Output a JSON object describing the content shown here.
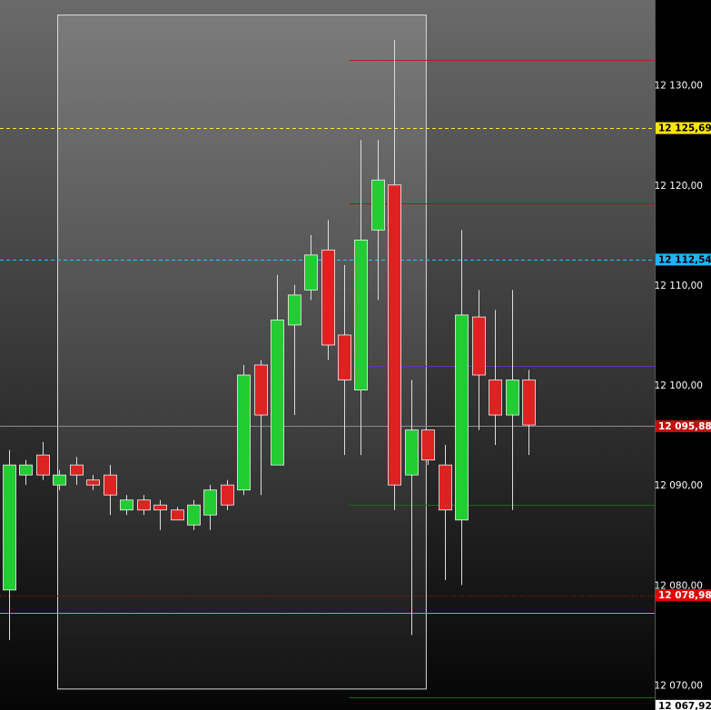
{
  "chart_data": {
    "type": "candlestick",
    "title": "",
    "xlabel": "",
    "ylabel": "",
    "ylim": [
      12067.5,
      12138.5
    ],
    "y_ticks": [
      {
        "value": 12130,
        "label": "12 130,00"
      },
      {
        "value": 12120,
        "label": "12 120,00"
      },
      {
        "value": 12110,
        "label": "12 110,00"
      },
      {
        "value": 12100,
        "label": "12 100,00"
      },
      {
        "value": 12090,
        "label": "12 090,00"
      },
      {
        "value": 12080,
        "label": "12 080,00"
      },
      {
        "value": 12070,
        "label": "12 070,00"
      }
    ],
    "candles": [
      {
        "o": 12079.5,
        "h": 12093.5,
        "l": 12074.5,
        "c": 12092.0
      },
      {
        "o": 12091.0,
        "h": 12092.5,
        "l": 12090.0,
        "c": 12092.0
      },
      {
        "o": 12093.0,
        "h": 12094.3,
        "l": 12090.5,
        "c": 12091.0
      },
      {
        "o": 12090.0,
        "h": 12091.5,
        "l": 12089.5,
        "c": 12091.0
      },
      {
        "o": 12092.0,
        "h": 12092.8,
        "l": 12090.0,
        "c": 12091.0
      },
      {
        "o": 12090.5,
        "h": 12091.0,
        "l": 12089.5,
        "c": 12090.0
      },
      {
        "o": 12091.0,
        "h": 12092.0,
        "l": 12087.0,
        "c": 12089.0
      },
      {
        "o": 12087.5,
        "h": 12089.0,
        "l": 12087.0,
        "c": 12088.5
      },
      {
        "o": 12088.5,
        "h": 12089.0,
        "l": 12087.0,
        "c": 12087.5
      },
      {
        "o": 12088.0,
        "h": 12088.5,
        "l": 12085.5,
        "c": 12087.5
      },
      {
        "o": 12087.5,
        "h": 12087.8,
        "l": 12086.5,
        "c": 12086.5
      },
      {
        "o": 12086.0,
        "h": 12088.5,
        "l": 12085.5,
        "c": 12088.0
      },
      {
        "o": 12087.0,
        "h": 12090.0,
        "l": 12085.5,
        "c": 12089.5
      },
      {
        "o": 12090.0,
        "h": 12090.5,
        "l": 12087.5,
        "c": 12088.0
      },
      {
        "o": 12089.5,
        "h": 12102.0,
        "l": 12089.0,
        "c": 12101.0
      },
      {
        "o": 12102.0,
        "h": 12102.5,
        "l": 12089.0,
        "c": 12097.0
      },
      {
        "o": 12092.0,
        "h": 12111.0,
        "l": 12092.0,
        "c": 12106.5
      },
      {
        "o": 12106.0,
        "h": 12110.0,
        "l": 12097.0,
        "c": 12109.0
      },
      {
        "o": 12109.5,
        "h": 12115.0,
        "l": 12108.5,
        "c": 12113.0
      },
      {
        "o": 12113.5,
        "h": 12116.5,
        "l": 12102.5,
        "c": 12104.0
      },
      {
        "o": 12105.0,
        "h": 12112.0,
        "l": 12093.0,
        "c": 12100.5
      },
      {
        "o": 12099.5,
        "h": 12124.5,
        "l": 12093.0,
        "c": 12114.5
      },
      {
        "o": 12115.5,
        "h": 12124.5,
        "l": 12108.5,
        "c": 12120.5
      },
      {
        "o": 12120.0,
        "h": 12134.5,
        "l": 12087.5,
        "c": 12090.0
      },
      {
        "o": 12091.0,
        "h": 12100.5,
        "l": 12075.0,
        "c": 12095.5
      },
      {
        "o": 12095.5,
        "h": 12095.5,
        "l": 12092.0,
        "c": 12092.5
      },
      {
        "o": 12092.0,
        "h": 12094.0,
        "l": 12080.5,
        "c": 12087.5
      },
      {
        "o": 12086.5,
        "h": 12115.5,
        "l": 12080.0,
        "c": 12107.0
      },
      {
        "o": 12106.8,
        "h": 12109.5,
        "l": 12095.5,
        "c": 12101.0
      },
      {
        "o": 12100.5,
        "h": 12107.5,
        "l": 12094.0,
        "c": 12097.0
      },
      {
        "o": 12097.0,
        "h": 12109.5,
        "l": 12087.5,
        "c": 12100.5
      },
      {
        "o": 12100.5,
        "h": 12101.5,
        "l": 12093.0,
        "c": 12096.0
      }
    ],
    "markers": [
      {
        "value": 12125.69,
        "label": "12 125,69",
        "line": "#ffe53a",
        "style": "dashed",
        "bg": "#ffe600",
        "fg": "#000000",
        "x_from": 0
      },
      {
        "value": 12112.54,
        "label": "12 112,54",
        "line": "#1ec8ff",
        "style": "dashed",
        "bg": "#1eb4ff",
        "fg": "#000000",
        "x_from": 0
      },
      {
        "value": 12095.88,
        "label": "12 095,88",
        "line": "#8a8a8a",
        "style": "solid",
        "bg": "#c01010",
        "fg": "#ffffff",
        "x_from": 0
      },
      {
        "value": 12078.98,
        "label": "12 078,98",
        "line": "#b01818",
        "style": "dotted",
        "bg": "#e00000",
        "fg": "#ffffff",
        "x_from": 0
      },
      {
        "value": 12067.92,
        "label": "12 067,92",
        "line": "#ffffff",
        "style": "none",
        "bg": "#ffffff",
        "fg": "#000000",
        "x_from": 0
      }
    ],
    "hlines": [
      {
        "value": 12132.5,
        "color": "#b02020",
        "from_index": 20.3
      },
      {
        "value": 12118.2,
        "color": "#a01818",
        "from_index": 20.3
      },
      {
        "value": 12101.9,
        "color": "#7030a0",
        "from_index": 20.3
      },
      {
        "value": 12088.0,
        "color": "#1a6a1a",
        "from_index": 20.3
      },
      {
        "value": 12077.2,
        "color": "#e070e0",
        "from_index": -1
      },
      {
        "value": 12068.8,
        "color": "#1a6a1a",
        "from_index": 20.3
      }
    ],
    "selection_range": {
      "from_index": 2.9,
      "to_index": 24.9,
      "y_top": 12137.0,
      "y_bottom": 12069.6
    },
    "colors": {
      "up": "#22cc33",
      "down": "#dd2222",
      "wick": "#dddddd",
      "axis_text": "#ffffff",
      "axis_bg": "#000000"
    }
  }
}
